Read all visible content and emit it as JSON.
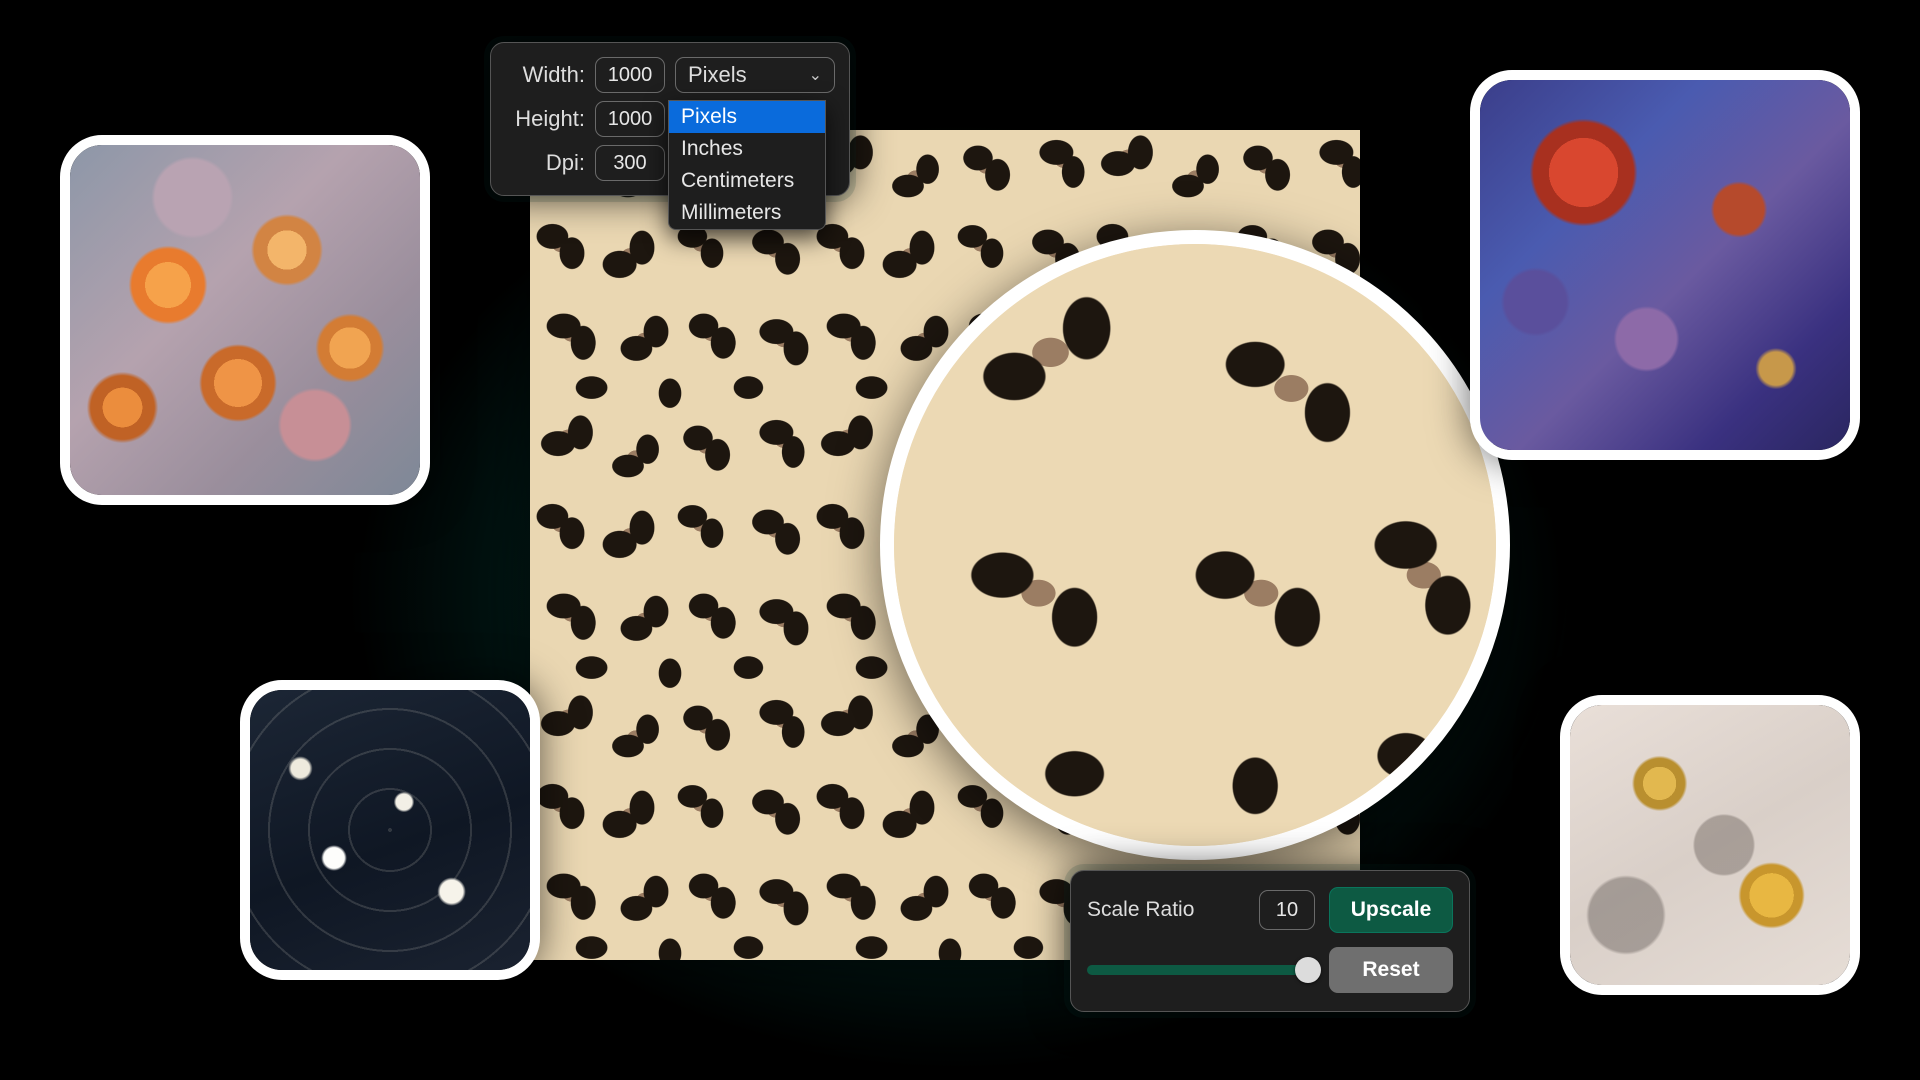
{
  "dimensions": {
    "width_label": "Width:",
    "height_label": "Height:",
    "dpi_label": "Dpi:",
    "width_value": "1000",
    "height_value": "1000",
    "dpi_value": "300",
    "unit_selected": "Pixels",
    "unit_options": [
      "Pixels",
      "Inches",
      "Centimeters",
      "Millimeters"
    ]
  },
  "scale": {
    "label": "Scale Ratio",
    "value": "10",
    "slider_min": 1,
    "slider_max": 10,
    "upscale_label": "Upscale",
    "reset_label": "Reset"
  },
  "colors": {
    "accent_green": "#0d5a43",
    "select_blue": "#0a6bdc",
    "panel_bg": "#1e1e1e"
  },
  "thumbnails": [
    {
      "name": "painted-orange-flowers"
    },
    {
      "name": "white-damask-on-navy"
    },
    {
      "name": "red-purple-brocade"
    },
    {
      "name": "gold-gray-floral"
    }
  ],
  "main_pattern": {
    "name": "leopard-print"
  }
}
